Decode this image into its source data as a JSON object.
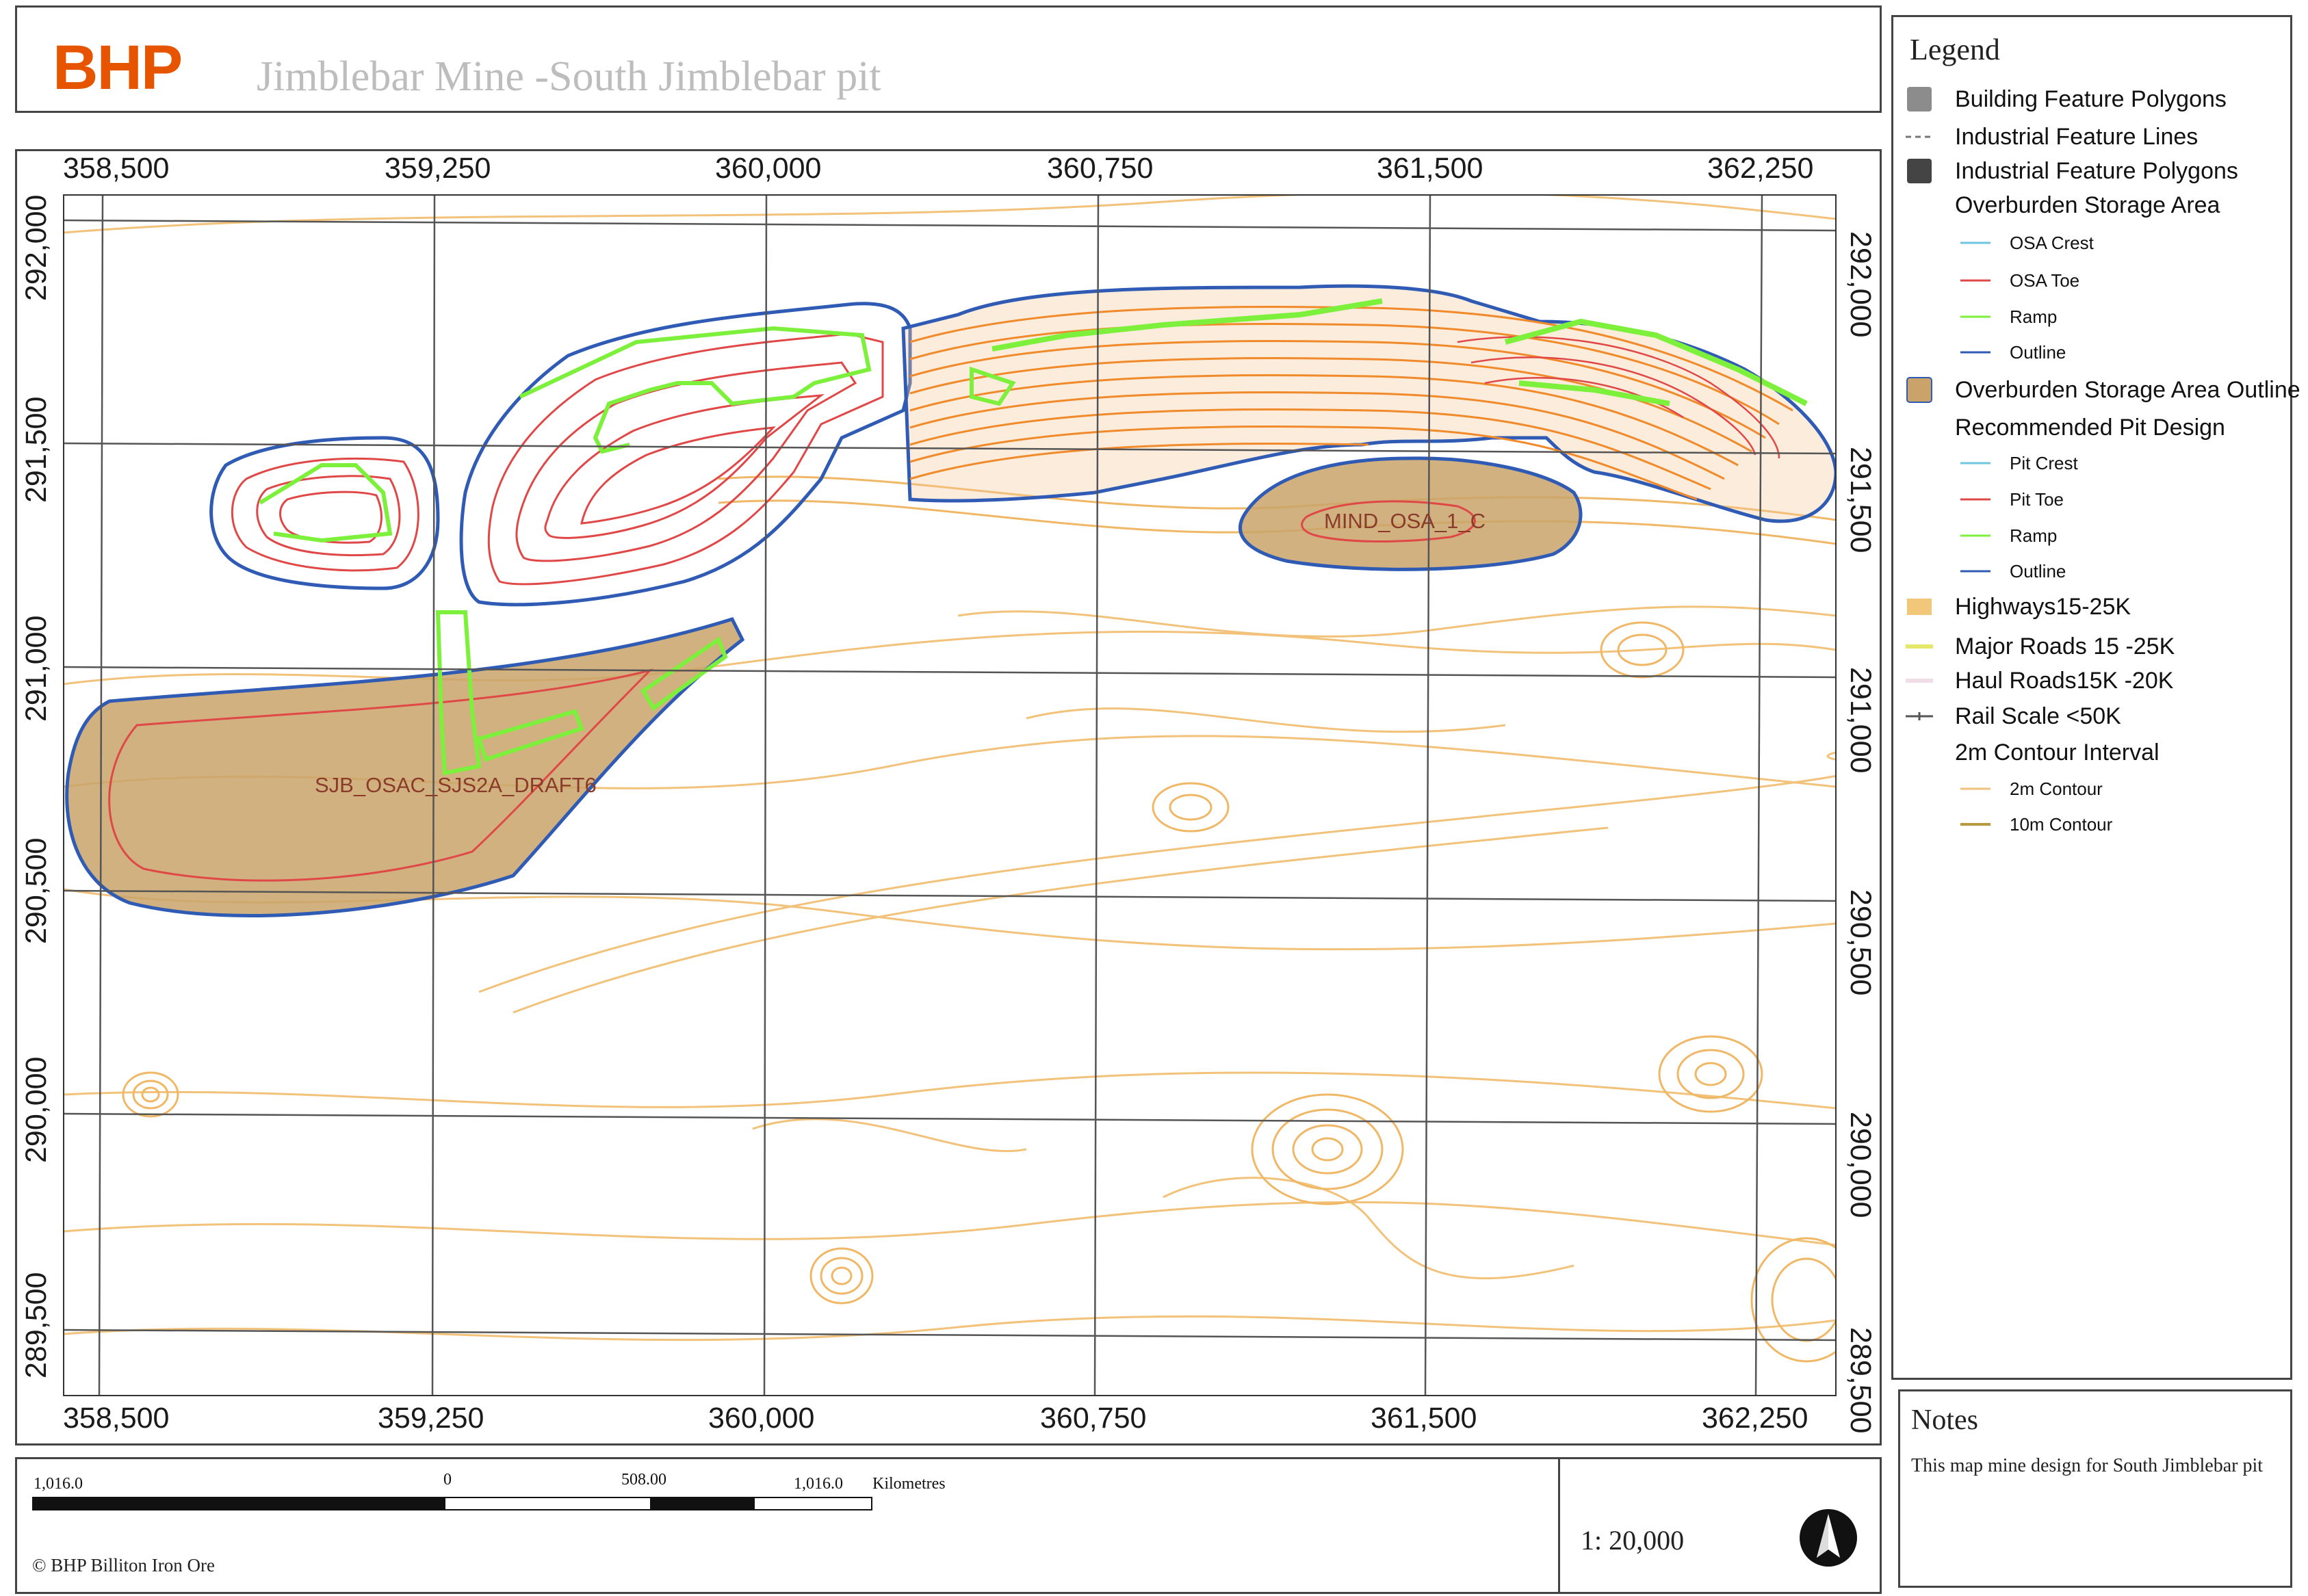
{
  "header": {
    "brand": "BHP",
    "title": "Jimblebar Mine -South Jimblebar pit"
  },
  "map": {
    "x_ticks": [
      "358,500",
      "359,250",
      "360,000",
      "360,750",
      "361,500",
      "362,250"
    ],
    "y_ticks": [
      "292,000",
      "291,500",
      "291,000",
      "290,500",
      "290,000",
      "289,500"
    ],
    "labels": {
      "osa_west": "SJB_OSAC_SJS2A_DRAFT6",
      "osa_east": "MIND_OSA_1_C"
    },
    "colors": {
      "contour": "#f2c27a",
      "contour_major": "#c8a24a",
      "osa_fill": "#c9a36a",
      "outline": "#2f5bb5",
      "ramp": "#7cf03a",
      "toe": "#e04848",
      "pit_contour": "#f08a2a"
    }
  },
  "legend": {
    "title": "Legend",
    "items": [
      {
        "label": "Building Feature Polygons",
        "symbol": "grey-square"
      },
      {
        "label": "Industrial Feature Lines",
        "symbol": "dashed-line"
      },
      {
        "label": "Industrial Feature Polygons",
        "symbol": "dark-square"
      },
      {
        "label": "Overburden Storage Area",
        "symbol": "none"
      },
      {
        "label": "OSA Crest",
        "symbol": "cyan-line",
        "sub": true
      },
      {
        "label": "OSA Toe",
        "symbol": "red-line",
        "sub": true
      },
      {
        "label": "Ramp",
        "symbol": "green-line",
        "sub": true
      },
      {
        "label": "Outline",
        "symbol": "blue-line",
        "sub": true
      },
      {
        "label": "Overburden Storage Area Outline",
        "symbol": "tan-square"
      },
      {
        "label": "Recommended Pit Design",
        "symbol": "none"
      },
      {
        "label": "Pit Crest",
        "symbol": "cyan-line",
        "sub": true
      },
      {
        "label": "Pit Toe",
        "symbol": "red-line",
        "sub": true
      },
      {
        "label": "Ramp",
        "symbol": "green-line",
        "sub": true
      },
      {
        "label": "Outline",
        "symbol": "blue-line",
        "sub": true
      },
      {
        "label": "Highways15-25K",
        "symbol": "orange-square"
      },
      {
        "label": "Major Roads 15   -25K",
        "symbol": "yellow-line"
      },
      {
        "label": "Haul Roads15K   -20K",
        "symbol": "pink-line"
      },
      {
        "label": "Rail Scale <50K",
        "symbol": "rail-line"
      },
      {
        "label": "2m Contour Interval",
        "symbol": "none"
      },
      {
        "label": "2m Contour",
        "symbol": "lightorange-line",
        "sub": true
      },
      {
        "label": "10m Contour",
        "symbol": "olive-line",
        "sub": true
      }
    ]
  },
  "notes": {
    "title": "Notes",
    "text": "This map mine design for South Jimblebar pit"
  },
  "scalebar": {
    "labels": [
      "1,016.0",
      "0",
      "508.00",
      "1,016.0"
    ],
    "units": "Kilometres",
    "ratio": "1:   20,000"
  },
  "footer": {
    "copyright": "© BHP Billiton Iron Ore"
  }
}
